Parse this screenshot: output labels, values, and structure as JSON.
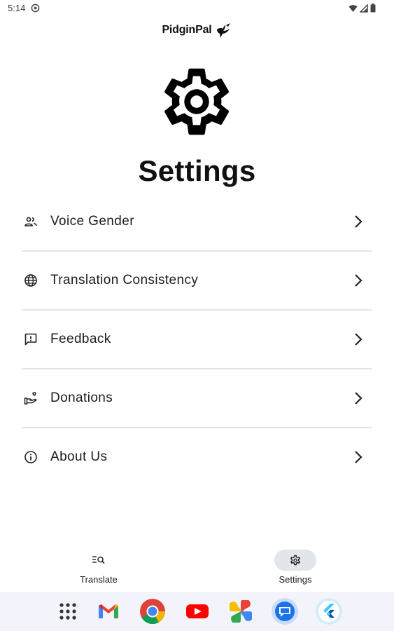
{
  "status_bar": {
    "time": "5:14",
    "icons": [
      "notification-icon",
      "wifi-icon",
      "signal-icon",
      "battery-icon"
    ]
  },
  "header": {
    "brand": "PidginPal",
    "brand_icon": "bird-icon",
    "hero_icon": "gear-icon",
    "title": "Settings"
  },
  "settings": {
    "items": [
      {
        "label": "Voice Gender",
        "icon": "people-icon"
      },
      {
        "label": "Translation Consistency",
        "icon": "globe-icon"
      },
      {
        "label": "Feedback",
        "icon": "feedback-icon"
      },
      {
        "label": "Donations",
        "icon": "donation-icon"
      },
      {
        "label": "About Us",
        "icon": "info-icon"
      }
    ]
  },
  "bottom_nav": {
    "items": [
      {
        "label": "Translate",
        "icon": "translate-search-icon",
        "active": false
      },
      {
        "label": "Settings",
        "icon": "gear-icon",
        "active": true
      }
    ],
    "active_color": "#e2e5e9"
  },
  "dock": {
    "apps": [
      "app-drawer-icon",
      "gmail-icon",
      "chrome-icon",
      "youtube-icon",
      "photos-icon",
      "messages-icon",
      "flutter-icon"
    ]
  }
}
